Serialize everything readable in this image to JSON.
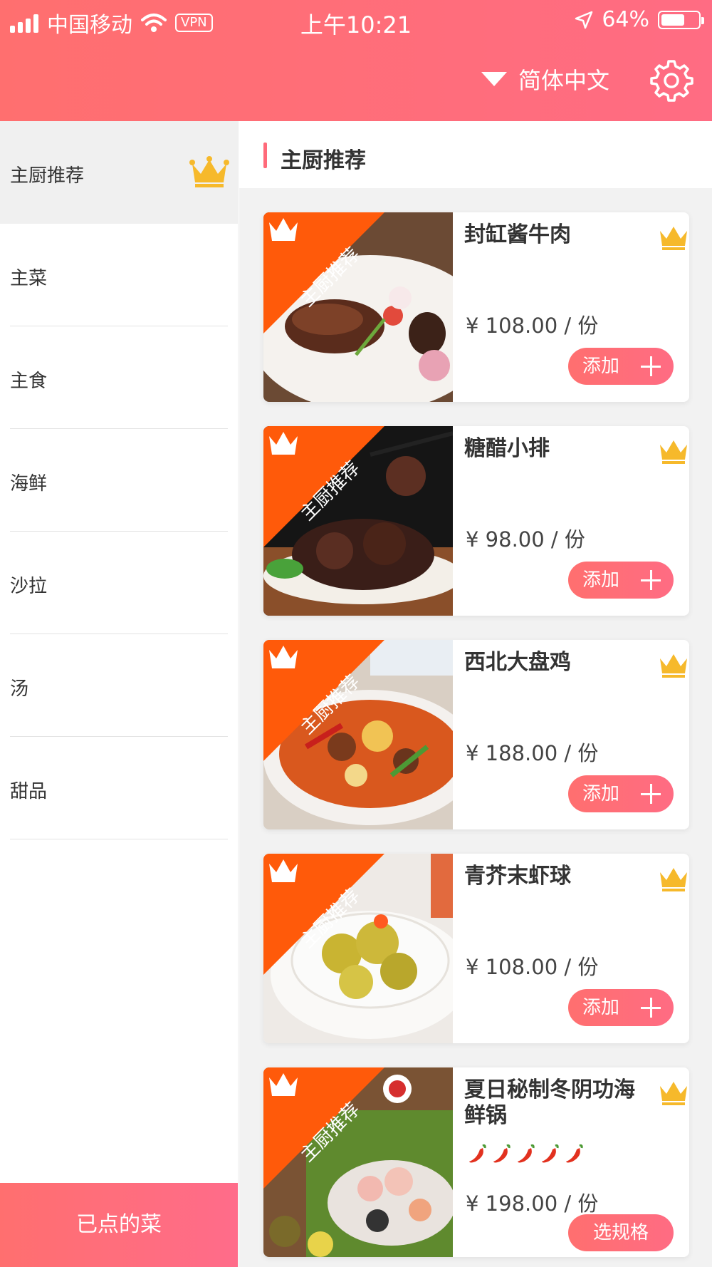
{
  "status_bar": {
    "carrier": "中国移动",
    "vpn": "VPN",
    "time": "上午10:21",
    "battery_text": "64%",
    "battery_level": 0.64
  },
  "header": {
    "language": "简体中文",
    "settings_icon": "gear-icon",
    "language_icon": "triangle-down-icon"
  },
  "sidebar": {
    "categories": [
      {
        "label": "主厨推荐",
        "active": true,
        "icon": "crown-icon"
      },
      {
        "label": "主菜"
      },
      {
        "label": "主食"
      },
      {
        "label": "海鲜"
      },
      {
        "label": "沙拉"
      },
      {
        "label": "汤"
      },
      {
        "label": "甜品"
      }
    ],
    "ordered_button": "已点的菜"
  },
  "section": {
    "title": "主厨推荐"
  },
  "badge_text": "主厨推荐",
  "dishes": [
    {
      "name": "封缸酱牛肉",
      "price": "¥ 108.00 / 份",
      "button": "添加"
    },
    {
      "name": "糖醋小排",
      "price": "¥ 98.00 / 份",
      "button": "添加"
    },
    {
      "name": "西北大盘鸡",
      "price": "¥ 188.00 / 份",
      "button": "添加"
    },
    {
      "name": "青芥末虾球",
      "price": "¥ 108.00 / 份",
      "button": "添加"
    },
    {
      "name": "夏日秘制冬阴功海鲜锅",
      "price": "¥ 198.00 / 份",
      "button": "选规格",
      "spice_level": 5
    }
  ],
  "colors": {
    "accent": "#ff6f78",
    "crown": "#f6b92b",
    "ribbon": "#ff5a0a"
  }
}
